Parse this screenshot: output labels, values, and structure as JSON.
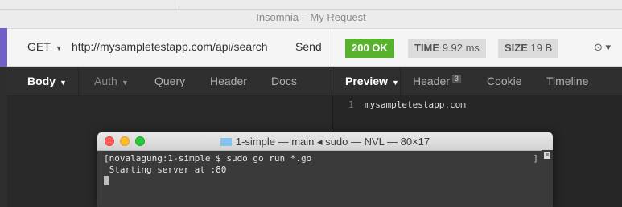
{
  "window": {
    "title": "Insomnia – My Request"
  },
  "request": {
    "method": "GET",
    "url": "http://mysampletestapp.com/api/search",
    "send_label": "Send",
    "tabs": [
      {
        "label": "Body",
        "active": true
      },
      {
        "label": "Auth",
        "dim": true
      },
      {
        "label": "Query"
      },
      {
        "label": "Header"
      },
      {
        "label": "Docs"
      }
    ]
  },
  "response": {
    "status": "200 OK",
    "time_label": "TIME",
    "time_value": "9.92 ms",
    "size_label": "SIZE",
    "size_value": "19 B",
    "tabs": {
      "preview": "Preview",
      "header": "Header",
      "header_count": "3",
      "cookie": "Cookie",
      "timeline": "Timeline"
    },
    "line_number": "1",
    "body_line": "mysampletestapp.com"
  },
  "terminal": {
    "title": "1-simple — main ◂ sudo — NVL — 80×17",
    "lines": [
      "[novalagung:1-simple $ sudo go run *.go",
      " Starting server at :80"
    ],
    "right_bracket": "]"
  },
  "colors": {
    "accent": "#6f5fc7",
    "status_ok": "#59b22d",
    "terminal_bg": "#3a3a3a"
  }
}
